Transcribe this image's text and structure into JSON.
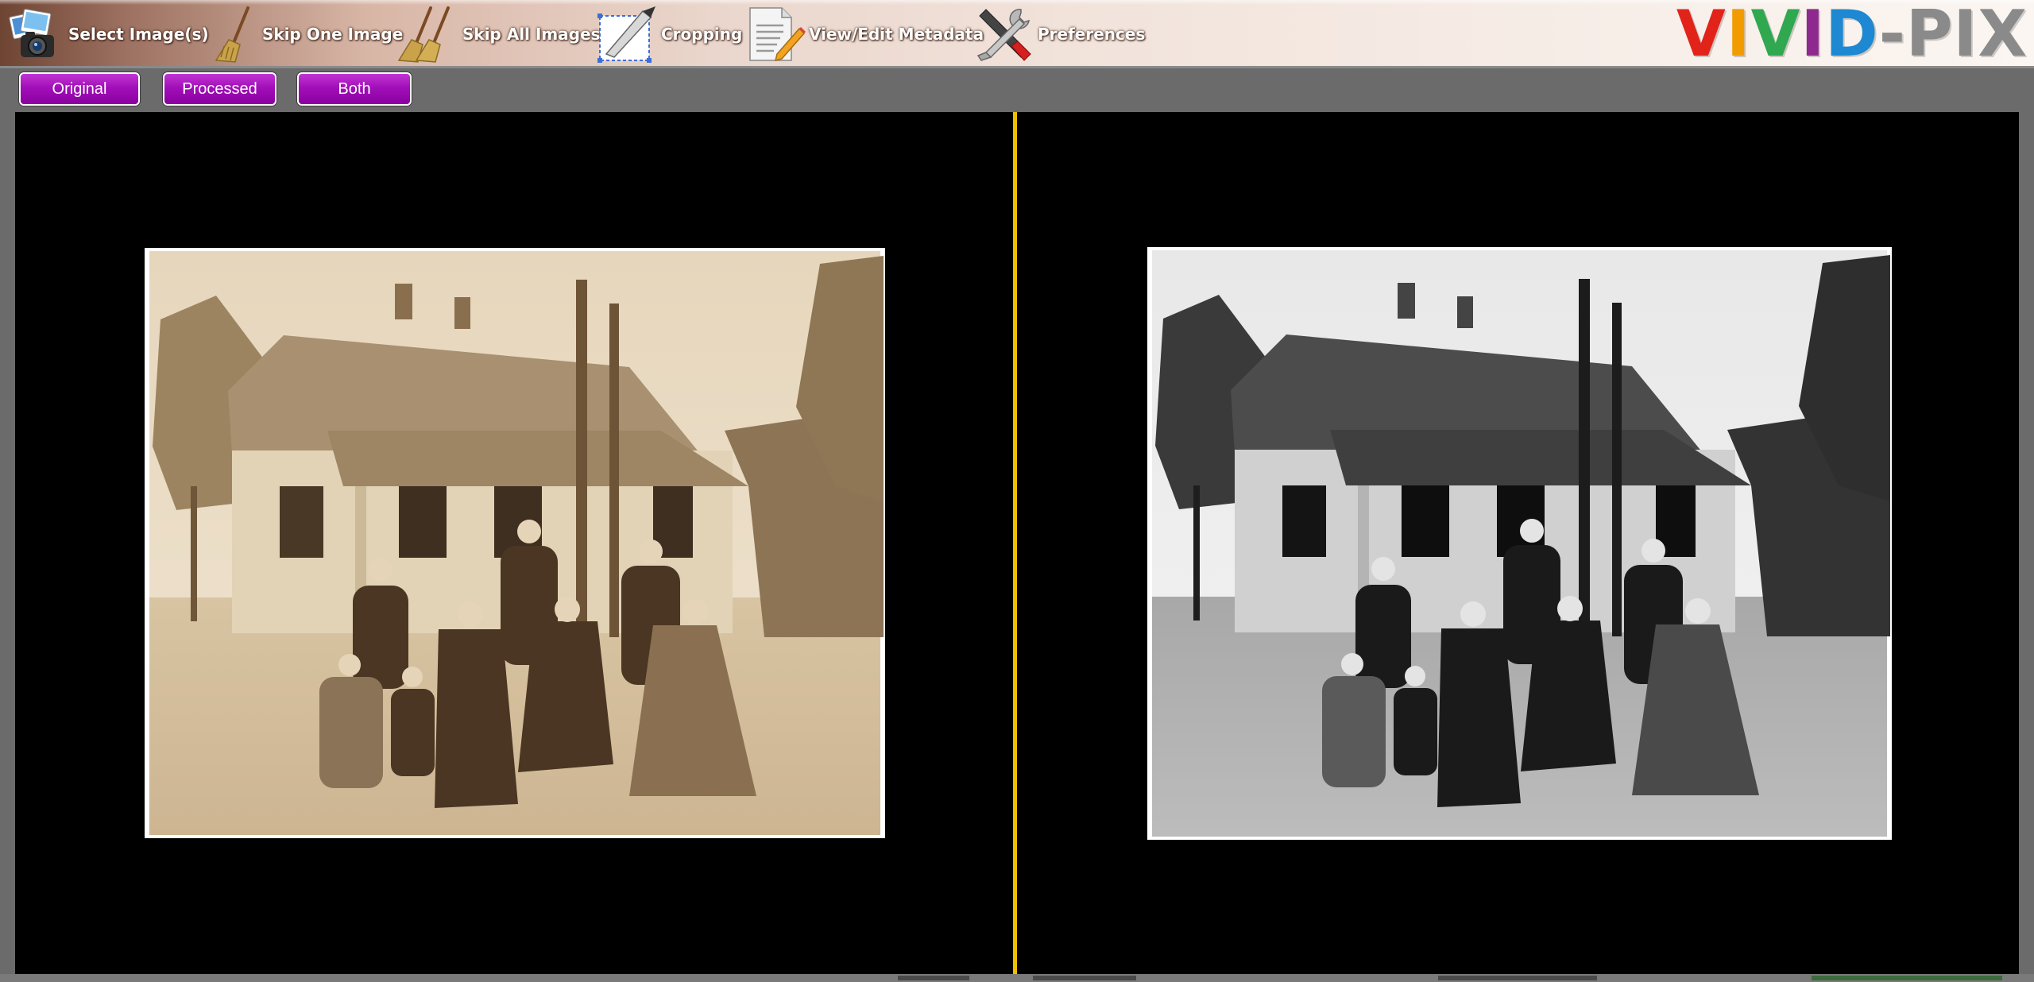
{
  "toolbar": {
    "items": [
      {
        "label": "Select Image(s)",
        "icon": "camera-photos-icon"
      },
      {
        "label": "Skip One Image",
        "icon": "broom-icon"
      },
      {
        "label": "Skip All Images",
        "icon": "double-broom-icon"
      },
      {
        "label": "Cropping",
        "icon": "crop-knife-icon"
      },
      {
        "label": "View/Edit Metadata",
        "icon": "document-pencil-icon"
      },
      {
        "label": "Preferences",
        "icon": "wrench-screwdriver-icon"
      }
    ],
    "logo": {
      "letters": [
        {
          "ch": "V",
          "color": "#e2231a"
        },
        {
          "ch": "I",
          "color": "#f29b00"
        },
        {
          "ch": "V",
          "color": "#2fa84f"
        },
        {
          "ch": "I",
          "color": "#8e2a8e"
        },
        {
          "ch": "D",
          "color": "#1e88d2"
        },
        {
          "ch": "-",
          "color": "#8a8a8a"
        },
        {
          "ch": "P",
          "color": "#8a8a8a"
        },
        {
          "ch": "I",
          "color": "#8a8a8a"
        },
        {
          "ch": "X",
          "color": "#8a8a8a"
        }
      ]
    }
  },
  "view_buttons": {
    "original": "Original",
    "processed": "Processed",
    "both": "Both"
  },
  "colors": {
    "accent": "#a10fb8",
    "divider": "#f0c000",
    "pane_bg": "#000000"
  }
}
